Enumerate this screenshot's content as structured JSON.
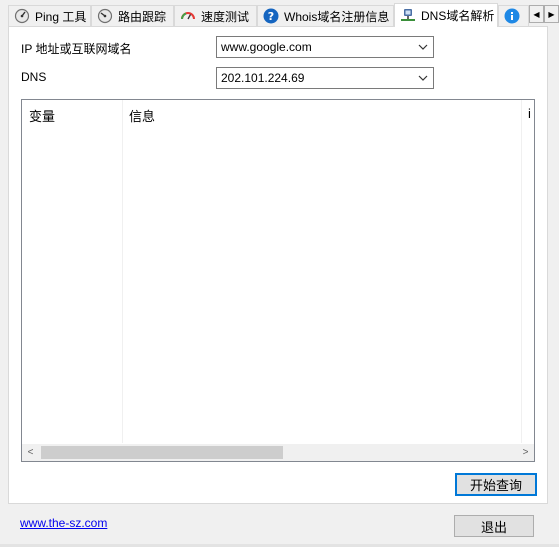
{
  "tabs": [
    {
      "label": "Ping 工具",
      "icon": "ping-gauge-icon"
    },
    {
      "label": "路由跟踪",
      "icon": "route-gauge-icon"
    },
    {
      "label": "速度测试",
      "icon": "speedometer-icon"
    },
    {
      "label": "Whois域名注册信息",
      "icon": "question-icon"
    },
    {
      "label": "DNS域名解析",
      "icon": "dns-network-icon",
      "active": true
    }
  ],
  "form": {
    "host_label": "IP 地址或互联网域名",
    "host_value": "www.google.com",
    "dns_label": "DNS",
    "dns_value": "202.101.224.69"
  },
  "results": {
    "columns": [
      "变量",
      "信息",
      "i"
    ]
  },
  "buttons": {
    "query": "开始查询",
    "exit": "退出"
  },
  "footer": {
    "link": "www.the-sz.com"
  }
}
